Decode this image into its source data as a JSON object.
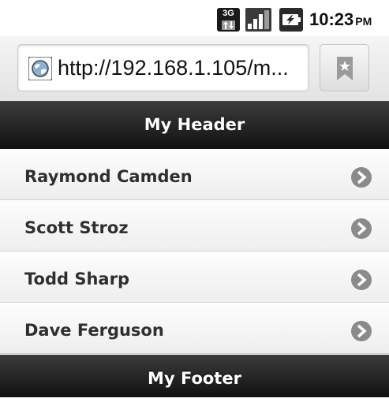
{
  "status_bar": {
    "network_type": "3G",
    "time": "10:23",
    "ampm": "PM",
    "icons": [
      "3g-data-icon",
      "signal-strength-icon",
      "battery-charging-icon"
    ]
  },
  "browser": {
    "url": "http://192.168.1.105/m...",
    "favicon": "globe-icon",
    "bookmark_icon": "bookmark-icon"
  },
  "page": {
    "header_title": "My Header",
    "list_items": [
      {
        "label": "Raymond Camden",
        "icon": "chevron-right-icon"
      },
      {
        "label": "Scott Stroz",
        "icon": "chevron-right-icon"
      },
      {
        "label": "Todd Sharp",
        "icon": "chevron-right-icon"
      },
      {
        "label": "Dave Ferguson",
        "icon": "chevron-right-icon"
      }
    ],
    "footer_title": "My Footer"
  },
  "colors": {
    "bar_dark": "#1e1e1e",
    "list_item_bg": "#f4f4f4",
    "list_text": "#2f2f2f",
    "arrow_circle": "#8a8a8a"
  }
}
